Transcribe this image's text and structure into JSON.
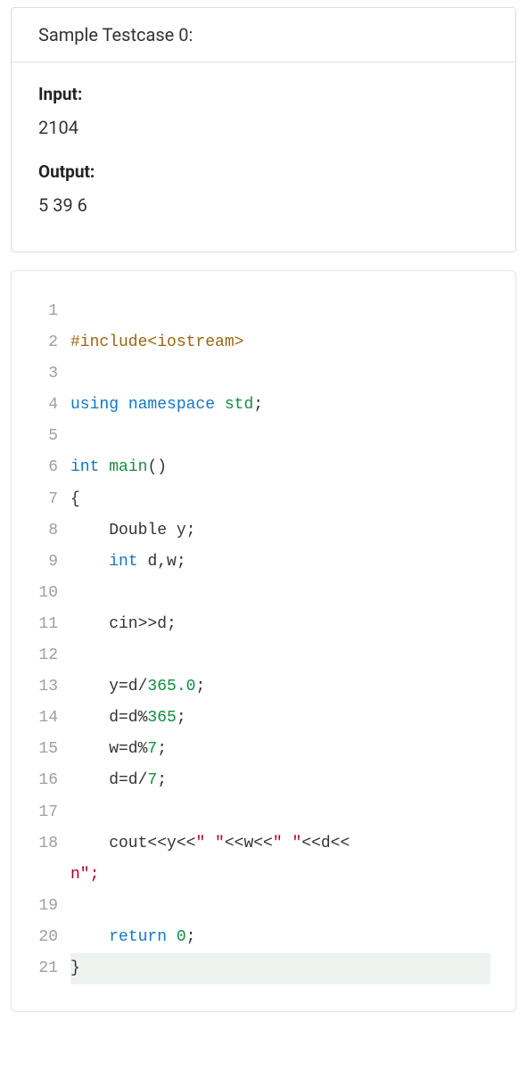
{
  "testcase": {
    "title": "Sample Testcase 0:",
    "input_label": "Input:",
    "input_value": "2104",
    "output_label": "Output:",
    "output_value": "5 39 6"
  },
  "code": {
    "lines": [
      {
        "num": "1",
        "parts": []
      },
      {
        "num": "2",
        "parts": [
          {
            "c": "k-pp",
            "t": "#include<iostream>"
          }
        ]
      },
      {
        "num": "3",
        "parts": []
      },
      {
        "num": "4",
        "parts": [
          {
            "c": "k-kw",
            "t": "using "
          },
          {
            "c": "k-ns",
            "t": "namespace "
          },
          {
            "c": "k-name",
            "t": "std"
          },
          {
            "c": "k-punct",
            "t": ";"
          }
        ]
      },
      {
        "num": "5",
        "parts": []
      },
      {
        "num": "6",
        "parts": [
          {
            "c": "k-type",
            "t": "int "
          },
          {
            "c": "k-name",
            "t": "main"
          },
          {
            "c": "k-punct",
            "t": "()"
          }
        ]
      },
      {
        "num": "7",
        "parts": [
          {
            "c": "k-punct",
            "t": "{"
          }
        ]
      },
      {
        "num": "8",
        "parts": [
          {
            "c": "k-ident",
            "t": "    Double y;"
          }
        ]
      },
      {
        "num": "9",
        "parts": [
          {
            "c": "k-ident",
            "t": "    "
          },
          {
            "c": "k-type",
            "t": "int "
          },
          {
            "c": "k-ident",
            "t": "d,w;"
          }
        ]
      },
      {
        "num": "10",
        "parts": []
      },
      {
        "num": "11",
        "parts": [
          {
            "c": "k-ident",
            "t": "    cin>>d;"
          }
        ]
      },
      {
        "num": "12",
        "parts": []
      },
      {
        "num": "13",
        "parts": [
          {
            "c": "k-ident",
            "t": "    y=d/"
          },
          {
            "c": "k-num",
            "t": "365.0"
          },
          {
            "c": "k-punct",
            "t": ";"
          }
        ]
      },
      {
        "num": "14",
        "parts": [
          {
            "c": "k-ident",
            "t": "    d=d%"
          },
          {
            "c": "k-num",
            "t": "365"
          },
          {
            "c": "k-punct",
            "t": ";"
          }
        ]
      },
      {
        "num": "15",
        "parts": [
          {
            "c": "k-ident",
            "t": "    w=d%"
          },
          {
            "c": "k-num",
            "t": "7"
          },
          {
            "c": "k-punct",
            "t": ";"
          }
        ]
      },
      {
        "num": "16",
        "parts": [
          {
            "c": "k-ident",
            "t": "    d=d/"
          },
          {
            "c": "k-num",
            "t": "7"
          },
          {
            "c": "k-punct",
            "t": ";"
          }
        ]
      },
      {
        "num": "17",
        "parts": []
      },
      {
        "num": "18",
        "parts": [
          {
            "c": "k-ident",
            "t": "    cout<<y<<"
          },
          {
            "c": "k-str",
            "t": "\" \""
          },
          {
            "c": "k-ident",
            "t": "<<w<<"
          },
          {
            "c": "k-str",
            "t": "\" \""
          },
          {
            "c": "k-ident",
            "t": "<<d<<"
          }
        ],
        "wrap": {
          "c": "k-str",
          "t": "n\";"
        }
      },
      {
        "num": "19",
        "parts": []
      },
      {
        "num": "20",
        "parts": [
          {
            "c": "k-ident",
            "t": "    "
          },
          {
            "c": "k-kw",
            "t": "return "
          },
          {
            "c": "k-num",
            "t": "0"
          },
          {
            "c": "k-punct",
            "t": ";"
          }
        ]
      },
      {
        "num": "21",
        "parts": [
          {
            "c": "k-punct",
            "t": "}"
          }
        ],
        "last": true
      }
    ]
  }
}
